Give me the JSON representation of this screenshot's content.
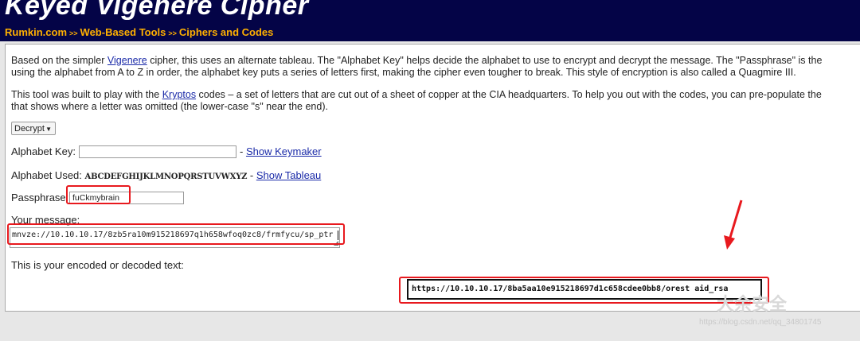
{
  "header": {
    "title": "Keyed Vigenère Cipher",
    "breadcrumb": [
      "Rumkin.com",
      "Web-Based Tools",
      "Ciphers and Codes"
    ],
    "separator": ">>"
  },
  "intro": {
    "line1_pre": "Based on the simpler ",
    "line1_link": "Vigenere",
    "line1_post": " cipher, this uses an alternate tableau. The \"Alphabet Key\" helps decide the alphabet to use to encrypt and decrypt the message. The \"Passphrase\" is the",
    "line2": "using the alphabet from A to Z in order, the alphabet key puts a series of letters first, making the cipher even tougher to break. This style of encryption is also called a Quagmire III.",
    "line3_pre": "This tool was built to play with the ",
    "line3_link": "Kryptos",
    "line3_post": " codes – a set of letters that are cut out of a sheet of copper at the CIA headquarters. To help you out with the codes, you can pre-populate the",
    "line4": "that shows where a letter was omitted (the lower-case \"s\" near the end)."
  },
  "form": {
    "mode_value": "Decrypt",
    "alphabet_key_label": "Alphabet Key:",
    "alphabet_key_value": "",
    "keymaker_sep": "-",
    "keymaker_link": "Show Keymaker",
    "alphabet_used_label": "Alphabet Used:",
    "alphabet_used_value": "ABCDEFGHIJKLMNOPQRSTUVWXYZ",
    "tableau_sep": "-",
    "tableau_link": "Show Tableau",
    "passphrase_label": "Passphrase:",
    "passphrase_value": "fuCkmybrain",
    "message_label": "Your message:",
    "message_value": "mnvze://10.10.10.17/8zb5ra10m915218697q1h658wfoq0zc8/frmfycu/sp_ptr",
    "result_label": "This is your encoded or decoded text:",
    "result_value": "https://10.10.10.17/8ba5aa10e915218697d1c658cdee0bb8/orest  aid_rsa"
  },
  "overlay": {
    "watermark": "https://blog.csdn.net/qq_34801745",
    "wechat_text": "大余安全",
    "highlight_color": "#e8191e"
  }
}
